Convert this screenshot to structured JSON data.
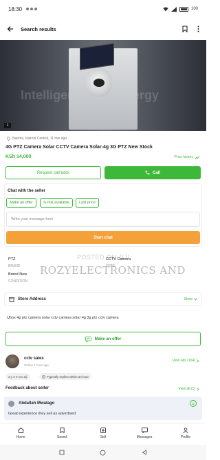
{
  "status": {
    "time": "18:30",
    "battery": "100"
  },
  "header": {
    "title": "Search results"
  },
  "hero": {
    "image_text": "Intelligent Solar Energy",
    "image_counter": "1"
  },
  "listing": {
    "location": "Nairobi, Nairobi Central, 11 min ago",
    "title": "4G PTZ Camera Solar CCTV Camera Solar-4g 3G PTZ New Stock",
    "price": "KSh 14,000",
    "price_history_label": "Price history",
    "request_callback_label": "Request call back",
    "call_label": "Call"
  },
  "chat": {
    "title": "Chat with the seller",
    "chips": [
      "Make an offer",
      "Is this available",
      "Last price"
    ],
    "message_placeholder": "Write your message here",
    "start_chat_label": "Start chat"
  },
  "specs": {
    "items": [
      {
        "value": "PTZ",
        "label": "BRAND"
      },
      {
        "value": "CCTV Camera",
        "label": "TYPE"
      },
      {
        "value": "Brand New",
        "label": "CONDITION"
      }
    ],
    "watermark_line1": "POSTED ON JIJI",
    "watermark_line2": "ROZYELECTRONICS AND"
  },
  "store": {
    "label": "Store Address",
    "show_label": "Show"
  },
  "description": "Ubox 4g ptz camera solar cctv camera solar 4g 3g ptz cctv camera",
  "make_offer_label": "Make an offer",
  "seller": {
    "name": "cctv sales",
    "online": "Online 1 hour ago",
    "view_ads": "View ads (164)",
    "tags": [
      "3 y 4 m on Jiji",
      "Typically replies within an hour"
    ]
  },
  "feedback": {
    "title": "Feedback about seller",
    "view_all": "View all (1)",
    "reviewer": "Abdallah Mwalago",
    "text": "Great experience they sell as advertised"
  },
  "bottom_nav": {
    "items": [
      {
        "label": "Home",
        "icon": "home-icon"
      },
      {
        "label": "Saved",
        "icon": "bookmark-icon"
      },
      {
        "label": "Sell",
        "icon": "plus-square-icon"
      },
      {
        "label": "Messages",
        "icon": "messages-icon"
      },
      {
        "label": "Profile",
        "icon": "profile-icon"
      }
    ]
  },
  "colors": {
    "accent_green": "#3db83a",
    "start_chat_orange": "#f4a13a"
  }
}
